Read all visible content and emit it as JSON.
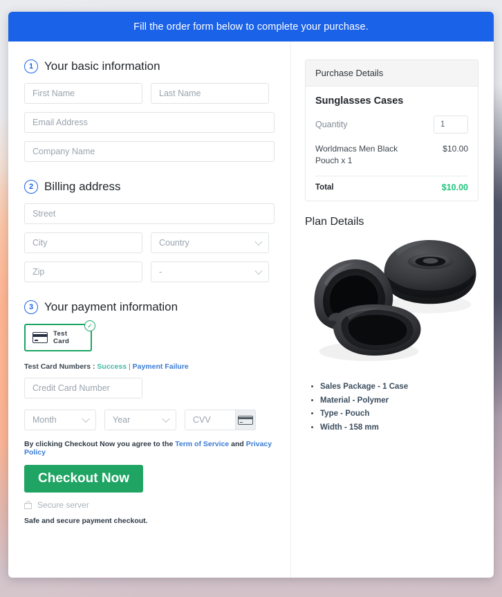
{
  "banner": {
    "text": "Fill the order form below to complete your purchase."
  },
  "steps": [
    {
      "num": "1",
      "title": "Your basic information"
    },
    {
      "num": "2",
      "title": "Billing address"
    },
    {
      "num": "3",
      "title": "Your payment information"
    }
  ],
  "basic_info": {
    "first_name_placeholder": "First Name",
    "last_name_placeholder": "Last Name",
    "email_placeholder": "Email Address",
    "company_placeholder": "Company Name"
  },
  "billing": {
    "street_placeholder": "Street",
    "city_placeholder": "City",
    "country_placeholder": "Country",
    "zip_placeholder": "Zip",
    "state_placeholder": "-"
  },
  "payment": {
    "card_option_label": "Test Card",
    "card_option_selected": true,
    "check_glyph": "✓",
    "test_numbers_prefix": "Test Card Numbers :",
    "success_link": "Success",
    "separator": "|",
    "failure_link": "Payment Failure",
    "card_number_placeholder": "Credit Card Number",
    "month_placeholder": "Month",
    "year_placeholder": "Year",
    "cvv_placeholder": "CVV"
  },
  "terms": {
    "prefix": "By clicking Checkout Now you agree to the",
    "tos_link": "Term of Service",
    "and": "and",
    "privacy_link": "Privacy Policy"
  },
  "actions": {
    "checkout_label": "Checkout Now",
    "secure_server": "Secure server",
    "footnote": "Safe and secure payment checkout."
  },
  "purchase_details": {
    "header": "Purchase Details",
    "product_name": "Sunglasses Cases",
    "quantity_label": "Quantity",
    "quantity_value": "1",
    "line_item_desc": "Worldmacs Men Black Pouch x 1",
    "line_item_price": "$10.00",
    "total_label": "Total",
    "total_value": "$10.00"
  },
  "plan_details": {
    "title": "Plan Details",
    "image_alt": "two black sunglasses cases, one open one closed",
    "bullets": [
      "Sales Package - 1 Case",
      "Material - Polymer",
      "Type - Pouch",
      "Width - 158 mm"
    ]
  },
  "colors": {
    "banner_blue": "#1a62e8",
    "accent_green": "#1fa463",
    "total_green": "#1fc47c",
    "link_blue": "#3a7bd5",
    "success_teal": "#3fb8a8"
  }
}
